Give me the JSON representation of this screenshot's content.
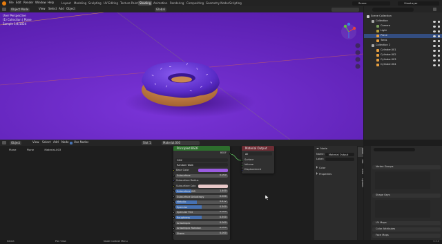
{
  "topbar": {
    "menus": [
      "File",
      "Edit",
      "Render",
      "Window",
      "Help"
    ],
    "workspaces": [
      "Layout",
      "Modeling",
      "Sculpting",
      "UV Editing",
      "Texture Paint",
      "Shading",
      "Animation",
      "Rendering",
      "Compositing",
      "Geometry Nodes",
      "Scripting"
    ],
    "active_workspace": "Shading",
    "scene": "Scene",
    "view_layer": "ViewLayer"
  },
  "viewport": {
    "header": {
      "mode": "Object Mode",
      "menus": [
        "View",
        "Select",
        "Add",
        "Object"
      ],
      "orientation": "Global"
    },
    "overlay_text": [
      "User Perspective",
      "(1) Collection | Plane",
      "Sample 1/4/1024"
    ],
    "colors": {
      "background": "#6a28c8"
    }
  },
  "node_editor": {
    "header": {
      "mode": "Object",
      "menus": [
        "View",
        "Select",
        "Add",
        "Node"
      ],
      "use_nodes": "Use Nodes",
      "slot": "Slot 1",
      "material": "Material.003"
    },
    "breadcrumb": [
      "Plane",
      "Plane",
      "Material.003"
    ],
    "principled": {
      "title": "Principled BSDF",
      "output": "BSDF",
      "dropdowns": [
        "GGX",
        "Random Walk"
      ],
      "properties": [
        {
          "label": "Base Color",
          "type": "color",
          "color": "#9a5ce0"
        },
        {
          "label": "Subsurface",
          "value": "0.000",
          "fill": 0
        },
        {
          "label": "Subsurface Radius",
          "type": "vector"
        },
        {
          "label": "Subsurface Colo",
          "type": "color",
          "color": "#e8c8c8"
        },
        {
          "label": "Subsurface IOR",
          "value": "1.400",
          "fill": 0.3
        },
        {
          "label": "Subsurface Anisotropy",
          "value": "0.000",
          "fill": 0
        },
        {
          "label": "Metallic",
          "value": "0.412",
          "fill": 0.41
        },
        {
          "label": "Specular",
          "value": "0.500",
          "fill": 0.5
        },
        {
          "label": "Specular Tint",
          "value": "0.000",
          "fill": 0
        },
        {
          "label": "Roughness",
          "value": "0.500",
          "fill": 0.5
        },
        {
          "label": "Anisotropic",
          "value": "0.000",
          "fill": 0
        },
        {
          "label": "Anisotropic Rotation",
          "value": "0.000",
          "fill": 0
        },
        {
          "label": "Sheen",
          "value": "0.000",
          "fill": 0
        }
      ]
    },
    "material_output": {
      "title": "Material Output",
      "target": "All",
      "inputs": [
        "Surface",
        "Volume",
        "Displacement"
      ]
    },
    "sidebar": {
      "section": "Node",
      "name_label": "Name:",
      "name_value": "Material Output",
      "label_label": "Label:",
      "color": "Color",
      "properties": "Properties",
      "tabs": [
        "Node",
        "Tool",
        "View",
        "Options"
      ]
    }
  },
  "outliner": {
    "items": [
      {
        "label": "Scene Collection",
        "depth": 0
      },
      {
        "label": "Collection",
        "depth": 1
      },
      {
        "label": "Camera",
        "depth": 2
      },
      {
        "label": "Light",
        "depth": 2
      },
      {
        "label": "Plane",
        "depth": 2,
        "selected": true
      },
      {
        "label": "Torus",
        "depth": 2
      },
      {
        "label": "Collection 2",
        "depth": 1
      },
      {
        "label": "Cylinder.001",
        "depth": 2
      },
      {
        "label": "Cylinder.002",
        "depth": 2
      },
      {
        "label": "Cylinder.003",
        "depth": 2
      },
      {
        "label": "Cylinder.004",
        "depth": 2
      }
    ]
  },
  "properties": {
    "sections": [
      "Vertex Groups",
      "Shape Keys",
      "UV Maps",
      "Color Attributes",
      "Face Maps"
    ]
  },
  "status": {
    "items": [
      "Select",
      "Pan View",
      "Node Context Menu"
    ],
    "version": "3.3.0"
  }
}
